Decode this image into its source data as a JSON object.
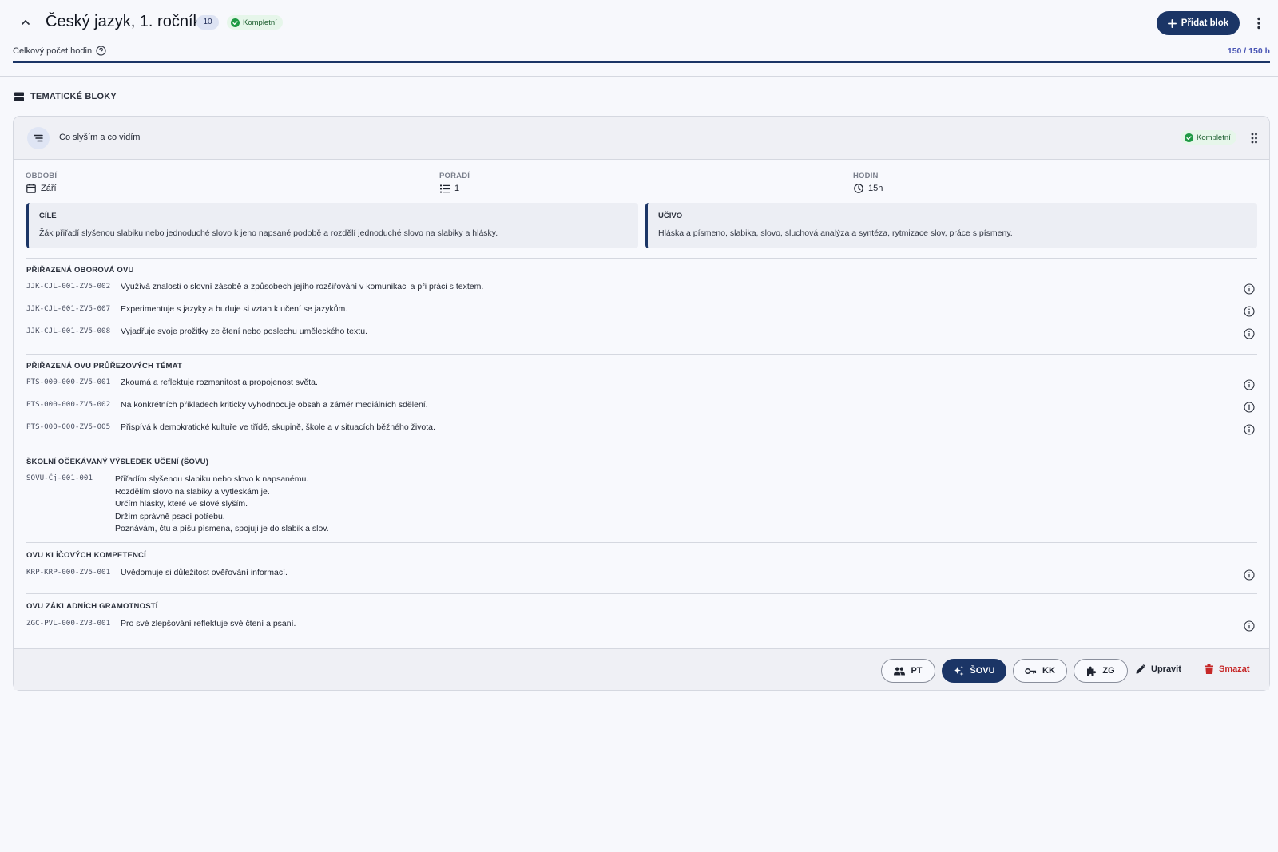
{
  "header": {
    "title": "Český jazyk, 1. ročník",
    "count": "10",
    "status": "Kompletní",
    "add_button": "Přidat blok",
    "hours_label": "Celkový počet hodin",
    "hours_value": "150 / 150 h",
    "hours_progress": 1.0
  },
  "section": {
    "title": "TEMATICKÉ BLOKY"
  },
  "block": {
    "name": "Co slyším a co vidím",
    "status": "Kompletní",
    "meta": {
      "period_label": "OBDOBÍ",
      "period_value": "Září",
      "order_label": "POŘADÍ",
      "order_value": "1",
      "hours_label": "HODIN",
      "hours_value": "15h"
    },
    "goals": {
      "title": "CÍLE",
      "text": "Žák přiřadí slyšenou slabiku nebo jednoduché slovo k jeho napsané podobě a rozdělí jednoduché slovo na slabiky a hlásky."
    },
    "curriculum": {
      "title": "UČIVO",
      "text": "Hláska a písmeno, slabika, slovo, sluchová analýza a syntéza, rytmizace slov, práce s písmeny."
    },
    "oborova": {
      "title": "PŘIŘAZENÁ OBOROVÁ OVU",
      "items": [
        {
          "code": "JJK-CJL-001-ZV5-002",
          "text": "Využívá znalosti o slovní zásobě a způsobech jejího rozšiřování v komunikaci a při práci s textem."
        },
        {
          "code": "JJK-CJL-001-ZV5-007",
          "text": "Experimentuje s jazyky a buduje si vztah k učení se jazykům."
        },
        {
          "code": "JJK-CJL-001-ZV5-008",
          "text": "Vyjadřuje svoje prožitky ze čtení nebo poslechu uměleckého textu."
        }
      ]
    },
    "prurezova": {
      "title": "PŘIŘAZENÁ OVU PRŮŘEZOVÝCH TÉMAT",
      "items": [
        {
          "code": "PTS-000-000-ZV5-001",
          "text": "Zkoumá a reflektuje rozmanitost a propojenost světa."
        },
        {
          "code": "PTS-000-000-ZV5-002",
          "text": "Na konkrétních příkladech kriticky vyhodnocuje obsah a záměr mediálních sdělení."
        },
        {
          "code": "PTS-000-000-ZV5-005",
          "text": "Přispívá k demokratické kultuře ve třídě, skupině, škole a v situacích běžného života."
        }
      ]
    },
    "sovu": {
      "title": "ŠKOLNÍ OČEKÁVANÝ VÝSLEDEK UČENÍ (ŠOVU)",
      "code": "SOVU-Čj-001-001",
      "lines": [
        "Přiřadím slyšenou slabiku nebo slovo k napsanému.",
        "Rozdělím slovo na slabiky a vytleskám je.",
        "Určím hlásky, které ve slově slyším.",
        "Držím správně psací potřebu.",
        "Poznávám, čtu a píšu písmena, spojuji je do slabik a slov."
      ]
    },
    "klicove": {
      "title": "OVU KLÍČOVÝCH KOMPETENCÍ",
      "items": [
        {
          "code": "KRP-KRP-000-ZV5-001",
          "text": "Uvědomuje si důležitost ověřování informací."
        }
      ]
    },
    "gramotnosti": {
      "title": "OVU ZÁKLADNÍCH GRAMOTNOSTÍ",
      "items": [
        {
          "code": "ZGC-PVL-000-ZV3-001",
          "text": "Pro své zlepšování reflektuje své čtení a psaní."
        }
      ]
    },
    "footer": {
      "pt": "PT",
      "sovu": "ŠOVU",
      "kk": "KK",
      "zg": "ZG",
      "edit": "Upravit",
      "delete": "Smazat"
    }
  },
  "icons": {
    "collapse": "chevron-up-icon",
    "check": "check-circle-icon",
    "add": "plus-icon",
    "more": "more-vertical-icon",
    "help": "help-circle-icon",
    "blocks": "stacked-blocks-icon",
    "block": "list-icon",
    "drag": "drag-handle-icon",
    "calendar": "calendar-icon",
    "order": "numbered-list-icon",
    "clock": "clock-icon",
    "info": "info-icon",
    "people": "people-icon",
    "sparkle": "sparkle-icon",
    "key": "key-icon",
    "puzzle": "puzzle-icon",
    "pencil": "pencil-icon",
    "trash": "trash-icon"
  },
  "colors": {
    "primary": "#1b3566",
    "success": "#1f9a44",
    "danger": "#c62828",
    "link": "#4a56b5"
  }
}
